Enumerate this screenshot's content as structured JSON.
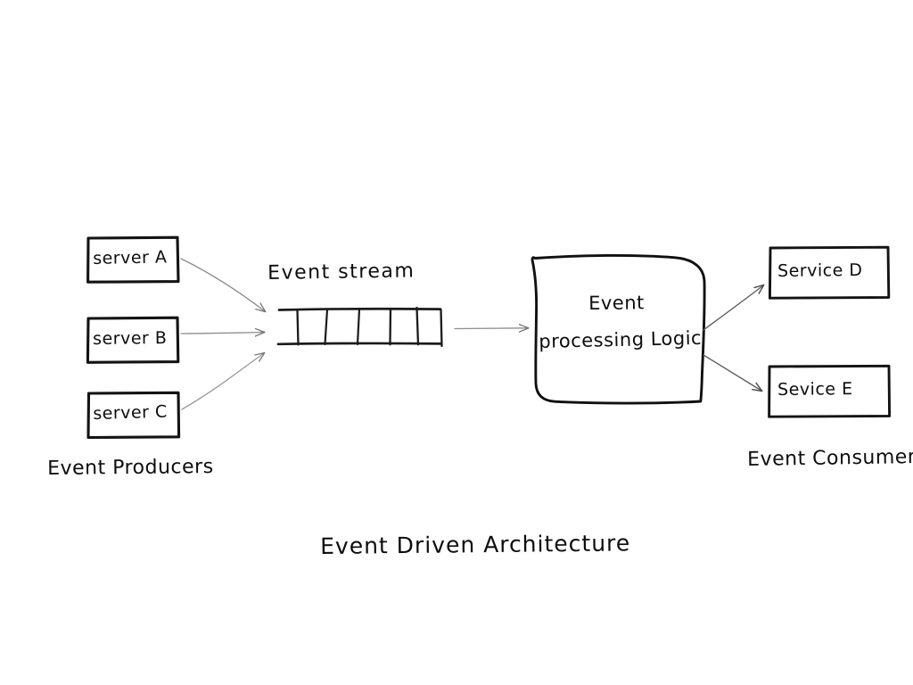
{
  "diagram": {
    "title": "Event Driven Architecture",
    "style": "hand-drawn whiteboard sketch",
    "background_color": "#ffffff",
    "ink_color": "#111111",
    "arrow_color": "#6b6b6b"
  },
  "producers": {
    "group_label": "Event  Producers",
    "boxes": [
      {
        "id": "server-a",
        "label": "server A"
      },
      {
        "id": "server-b",
        "label": "server B"
      },
      {
        "id": "server-c",
        "label": "server C"
      }
    ]
  },
  "stream": {
    "label": "Event  stream",
    "segment_count": 6
  },
  "processor": {
    "line1": "Event",
    "line2": "processing Logic"
  },
  "consumers": {
    "group_label": "Event Consumers",
    "boxes": [
      {
        "id": "service-d",
        "label": "Service D"
      },
      {
        "id": "service-e",
        "label": "Sevice E"
      }
    ]
  },
  "connections": [
    {
      "from": "server-a",
      "to": "stream"
    },
    {
      "from": "server-b",
      "to": "stream"
    },
    {
      "from": "server-c",
      "to": "stream"
    },
    {
      "from": "stream",
      "to": "processor"
    },
    {
      "from": "processor",
      "to": "service-d"
    },
    {
      "from": "processor",
      "to": "service-e"
    }
  ]
}
